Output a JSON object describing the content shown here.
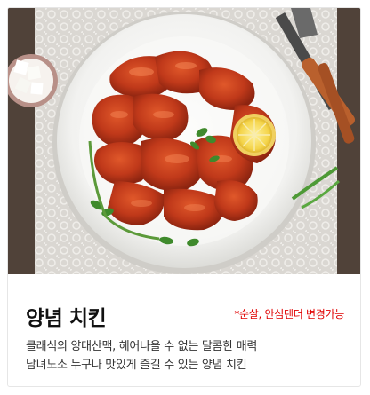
{
  "product": {
    "name": "양념 치킨",
    "note": "*순살, 안심텐더 변경가능",
    "description": [
      "클래식의 양대산맥, 헤어나올 수 없는 달콤한 매력",
      "남녀노소 누구나 맛있게 즐길 수 있는 양념 치킨"
    ]
  },
  "colors": {
    "note": "#e00000",
    "sauce": "#c0391a",
    "plate": "#f5f5f3"
  }
}
